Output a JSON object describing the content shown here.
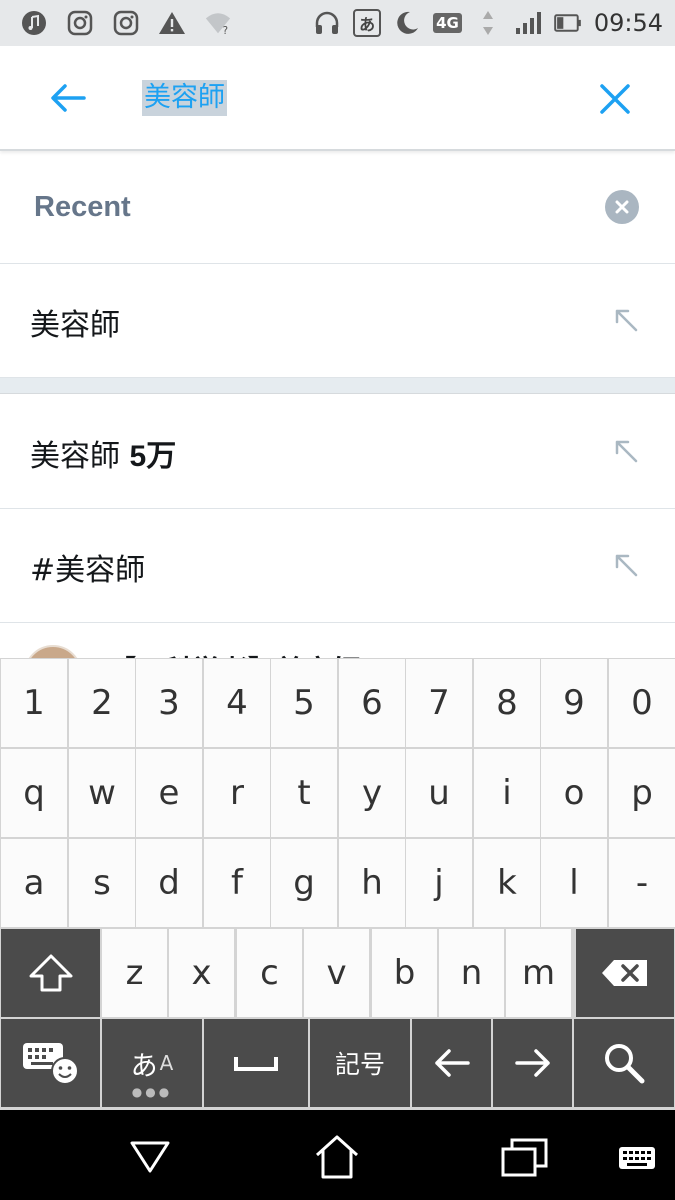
{
  "status_bar": {
    "time": "09:54",
    "network": "4G",
    "ime_indicator": "あ",
    "icons": [
      "music-icon",
      "instagram-icon",
      "instagram-icon",
      "warning-icon",
      "wifi-unknown-icon",
      "headphones-icon",
      "ime-icon",
      "moon-icon",
      "network-4g-icon",
      "signal-icon",
      "battery-icon"
    ]
  },
  "search": {
    "query": "美容師",
    "back_icon": "arrow-left-icon",
    "clear_icon": "close-icon",
    "accent_color": "#1da1f2"
  },
  "recent": {
    "title": "Recent",
    "items": [
      {
        "text": "美容師"
      }
    ]
  },
  "suggestions": [
    {
      "prefix": "美容師 ",
      "bold": "5万"
    },
    {
      "prefix": "#美容師",
      "bold": ""
    }
  ],
  "partial_result": {
    "text": "【元科学者】美容師"
  },
  "keyboard": {
    "row_numbers": [
      "1",
      "2",
      "3",
      "4",
      "5",
      "6",
      "7",
      "8",
      "9",
      "0"
    ],
    "row_q": [
      "q",
      "w",
      "e",
      "r",
      "t",
      "y",
      "u",
      "i",
      "o",
      "p"
    ],
    "row_a": [
      "a",
      "s",
      "d",
      "f",
      "g",
      "h",
      "j",
      "k",
      "l",
      "-"
    ],
    "row_z": [
      "z",
      "x",
      "c",
      "v",
      "b",
      "n",
      "m"
    ],
    "kana_label": "あ",
    "kana_sub": "A",
    "symbols_label": "記号"
  },
  "nav": {
    "icons": [
      "back-triangle-icon",
      "home-icon",
      "recents-icon",
      "keyboard-icon"
    ]
  }
}
